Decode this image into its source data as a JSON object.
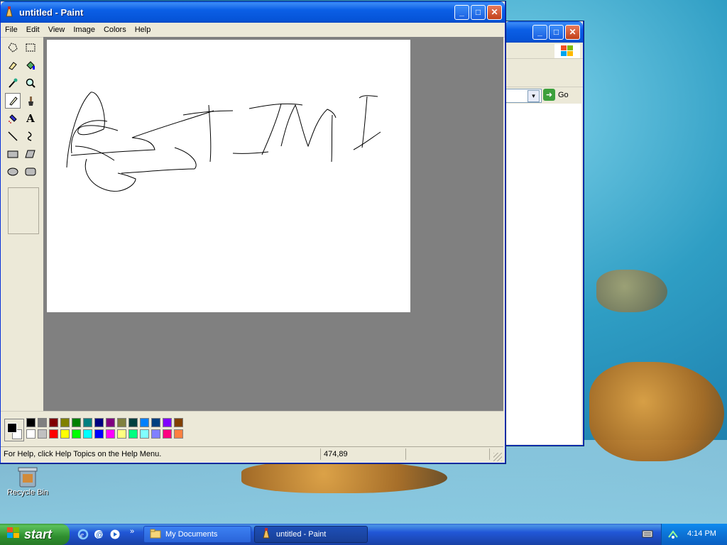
{
  "paint": {
    "title": "untitled - Paint",
    "menu": [
      "File",
      "Edit",
      "View",
      "Image",
      "Colors",
      "Help"
    ],
    "status_help": "For Help, click Help Topics on the Help Menu.",
    "status_coords": "474,89",
    "palette_top": [
      "#000000",
      "#808080",
      "#800000",
      "#808000",
      "#008000",
      "#008080",
      "#000080",
      "#800080",
      "#808040",
      "#004040",
      "#0080ff",
      "#004080",
      "#8000ff",
      "#804000"
    ],
    "palette_bottom": [
      "#ffffff",
      "#c0c0c0",
      "#ff0000",
      "#ffff00",
      "#00ff00",
      "#00ffff",
      "#0000ff",
      "#ff00ff",
      "#ffff80",
      "#00ff80",
      "#80ffff",
      "#8080ff",
      "#ff0080",
      "#ff8040"
    ]
  },
  "explorer": {
    "go_label": "Go"
  },
  "desktop": {
    "recycle_bin": "Recycle Bin"
  },
  "taskbar": {
    "start_label": "start",
    "tasks": [
      "My Documents",
      "untitled - Paint"
    ],
    "time": "4:14 PM"
  }
}
